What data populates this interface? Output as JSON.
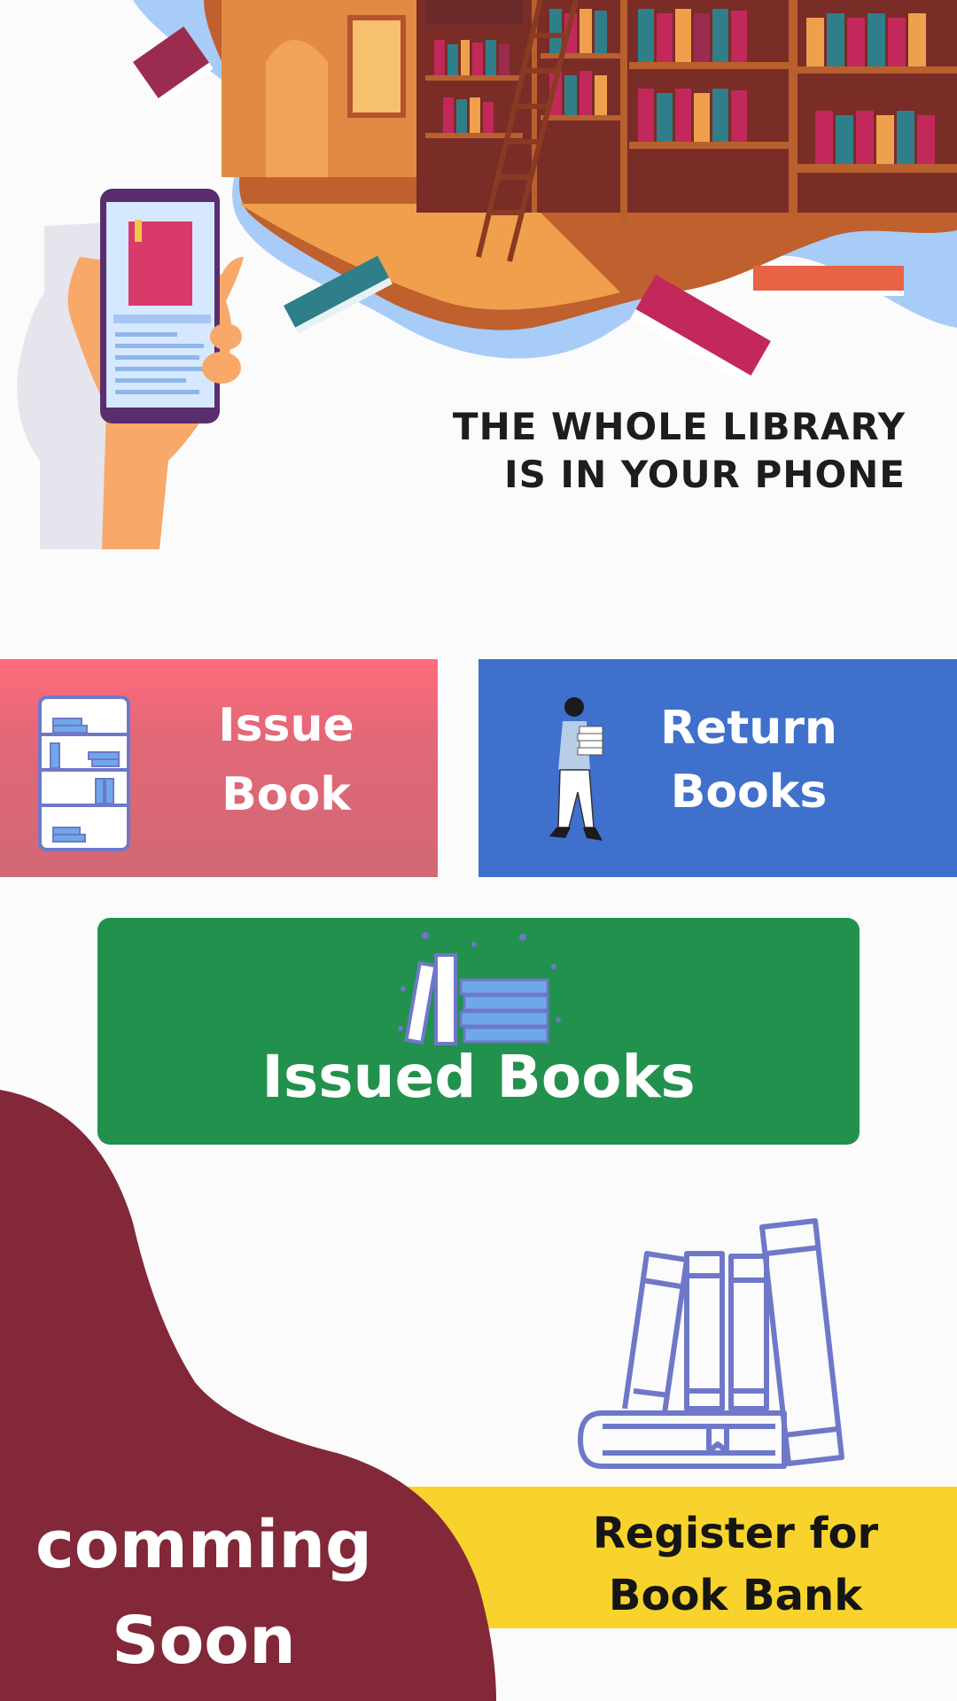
{
  "hero": {
    "headline_line1": "THE WHOLE LIBRARY",
    "headline_line2": "IS IN YOUR PHONE"
  },
  "tiles": {
    "issue": {
      "line1": "Issue",
      "line2": "Book",
      "color": "#e26877",
      "icon": "bookshelf-icon"
    },
    "return": {
      "line1": "Return",
      "line2": "Books",
      "color": "#3f70cc",
      "icon": "person-carrying-books-icon"
    },
    "issued": {
      "label": "Issued Books",
      "color": "#22914d",
      "icon": "book-stack-icon"
    }
  },
  "coming_soon": {
    "line1": "comming",
    "line2": "Soon",
    "color": "#822838"
  },
  "register": {
    "line1": "Register for",
    "line2": "Book Bank",
    "color": "#f8d32d",
    "icon": "standing-books-icon"
  }
}
